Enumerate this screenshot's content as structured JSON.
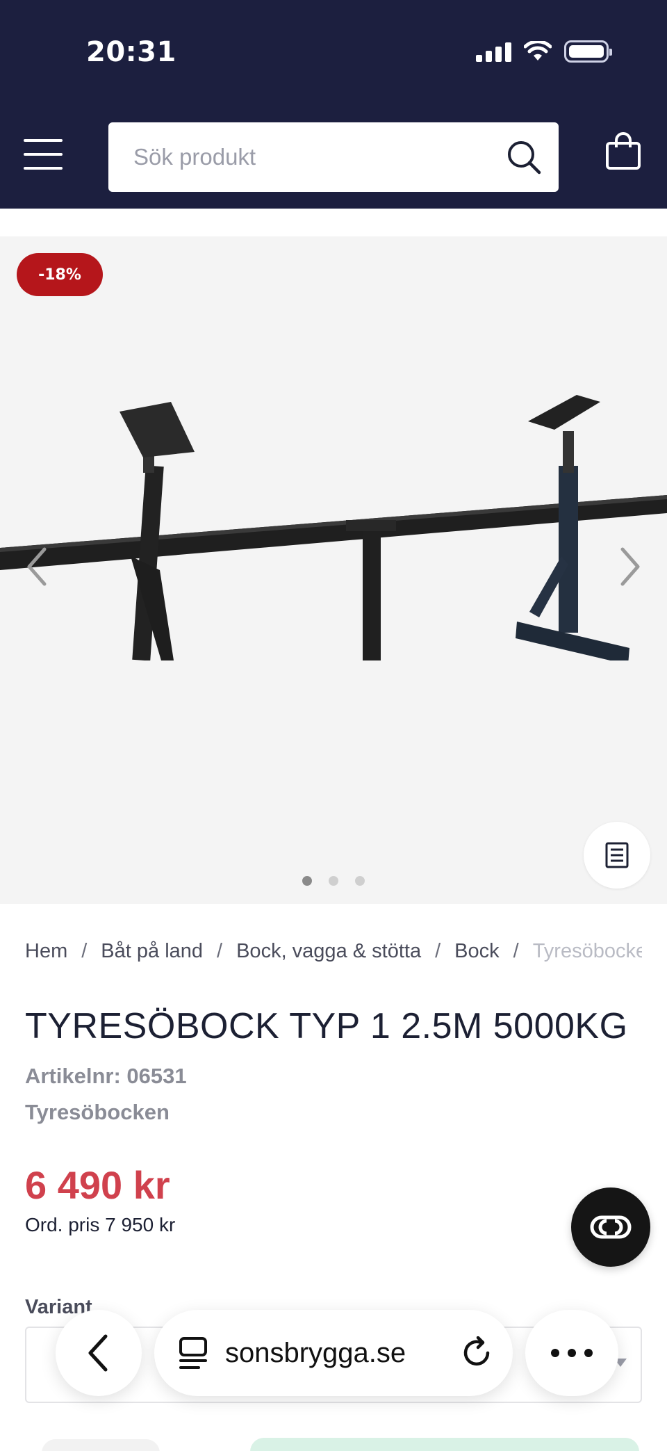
{
  "status_bar": {
    "time": "20:31"
  },
  "header": {
    "search_placeholder": "Sök produkt",
    "colors": {
      "background": "#1c1f3f"
    }
  },
  "gallery": {
    "discount_badge": "-18%",
    "image_count": 3,
    "active_image": 1,
    "image_alt": "Tyresöbock typ 1 bockställning"
  },
  "breadcrumb": {
    "items": [
      "Hem",
      "Båt på land",
      "Bock, vagga & stötta",
      "Bock"
    ],
    "current": "Tyresöbocken"
  },
  "product": {
    "title": "TYRESÖBOCK TYP 1 2.5M 5000KG",
    "article_nr": "Artikelnr: 06531",
    "brand": "Tyresöbocken",
    "price": "6 490 kr",
    "ordinary_price": "Ord. pris 7 950 kr",
    "variant_label": "Variant",
    "colors": {
      "price": "#d0414d",
      "badge": "#b5161b"
    }
  },
  "browser": {
    "url": "sonsbrygga.se"
  }
}
